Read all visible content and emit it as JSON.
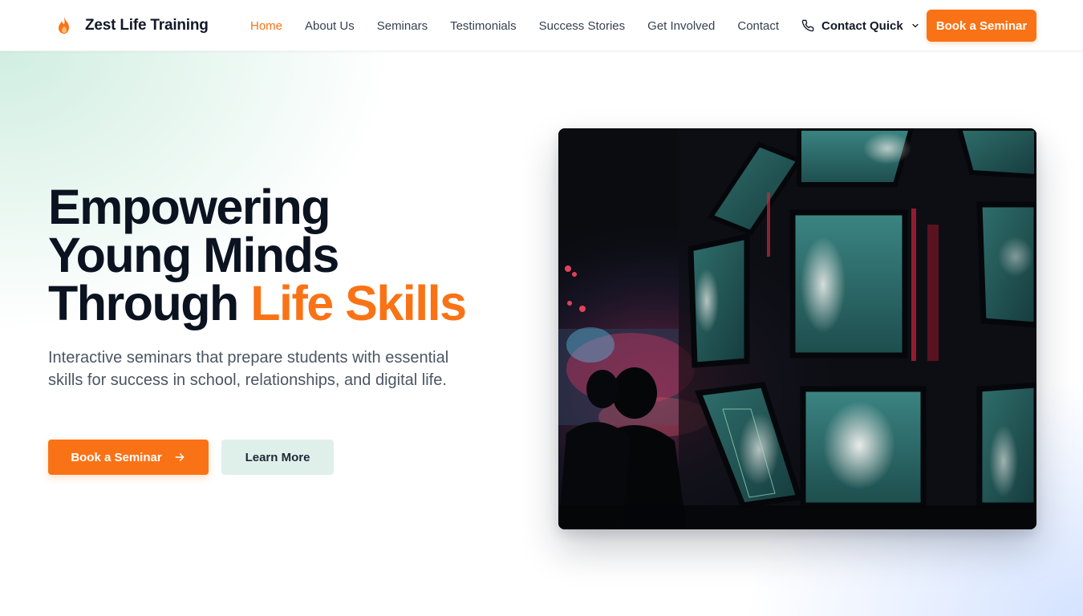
{
  "header": {
    "brand_name": "Zest Life Training",
    "brand_icon": "flame-icon",
    "nav": [
      {
        "label": "Home",
        "active": true
      },
      {
        "label": "About Us",
        "active": false
      },
      {
        "label": "Seminars",
        "active": false
      },
      {
        "label": "Testimonials",
        "active": false
      },
      {
        "label": "Success Stories",
        "active": false
      },
      {
        "label": "Get Involved",
        "active": false
      },
      {
        "label": "Contact",
        "active": false
      }
    ],
    "contact_quick_label": "Contact Quick",
    "book_button_label": "Book a Seminar"
  },
  "hero": {
    "headline_line1": "Empowering",
    "headline_line2": "Young Minds",
    "headline_line3": "Through ",
    "headline_accent": "Life Skills",
    "subtitle": "Interactive seminars that prepare students with essential skills for success in school, relationships, and digital life.",
    "primary_button_label": "Book a Seminar",
    "secondary_button_label": "Learn More"
  },
  "colors": {
    "accent": "#f97316",
    "text_dark": "#0b1220",
    "secondary_button_bg": "#dff0eb"
  }
}
